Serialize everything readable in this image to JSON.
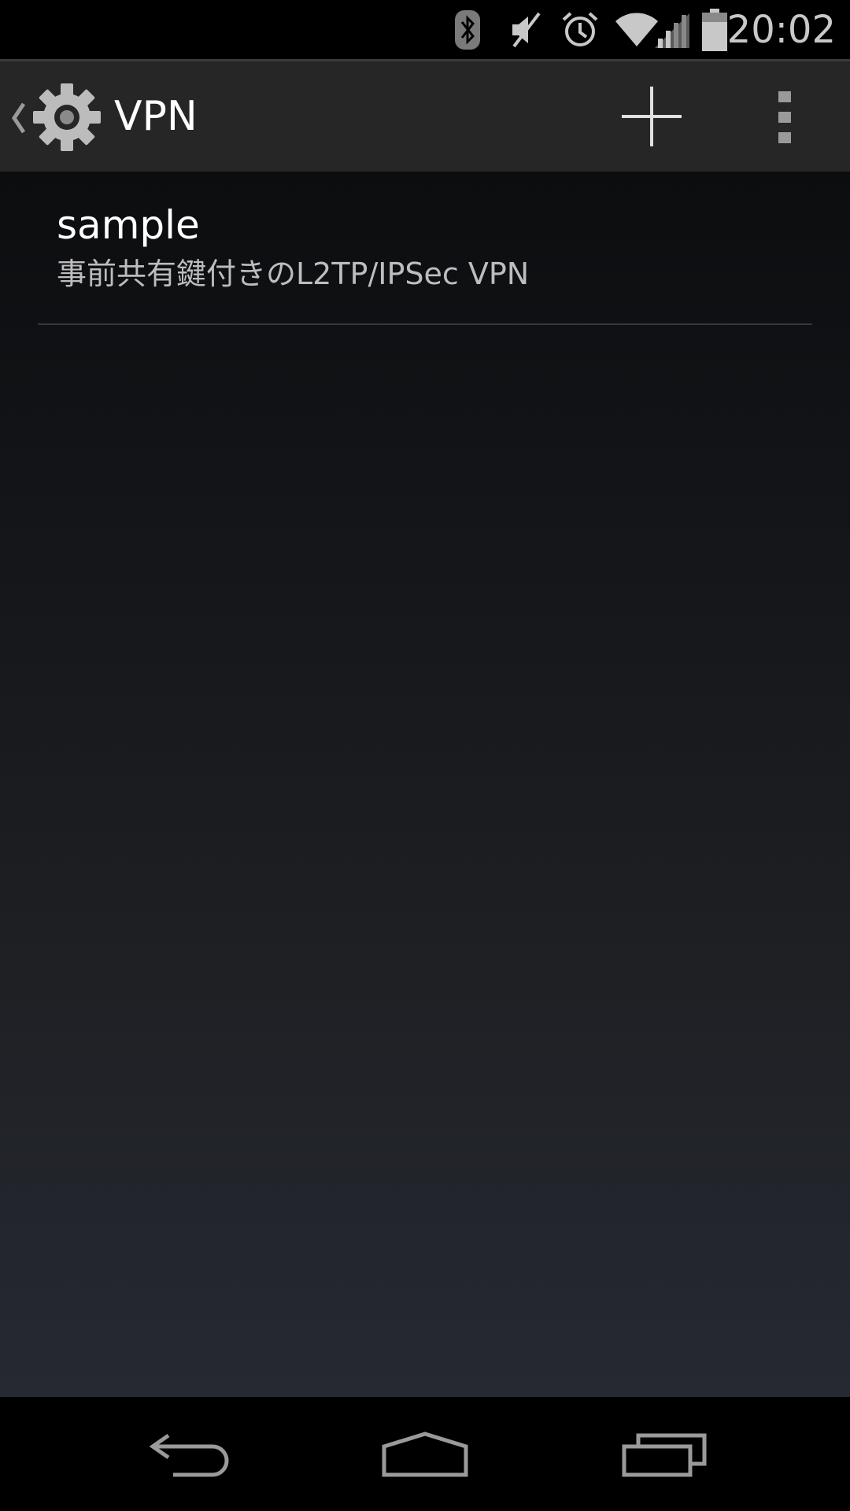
{
  "status_bar": {
    "time": "20:02",
    "icons": [
      "bluetooth-icon",
      "mute-icon",
      "alarm-icon",
      "wifi-icon",
      "cell-signal-icon",
      "battery-icon"
    ]
  },
  "action_bar": {
    "title": "VPN",
    "up_icon": "chevron-left-icon",
    "app_icon": "settings-gear-icon",
    "actions": [
      {
        "name": "add-vpn",
        "icon": "plus-icon"
      },
      {
        "name": "more-options",
        "icon": "overflow-menu-icon"
      }
    ]
  },
  "vpn_list": [
    {
      "name": "sample",
      "type": "事前共有鍵付きのL2TP/IPSec VPN"
    }
  ],
  "nav_bar": {
    "buttons": [
      "back-icon",
      "home-icon",
      "recents-icon"
    ]
  },
  "colors": {
    "action_bar_bg": "#262626",
    "status_bar_bg": "#000000",
    "icon_gray": "#c8c8c8",
    "secondary_text": "#bdbdbd"
  }
}
